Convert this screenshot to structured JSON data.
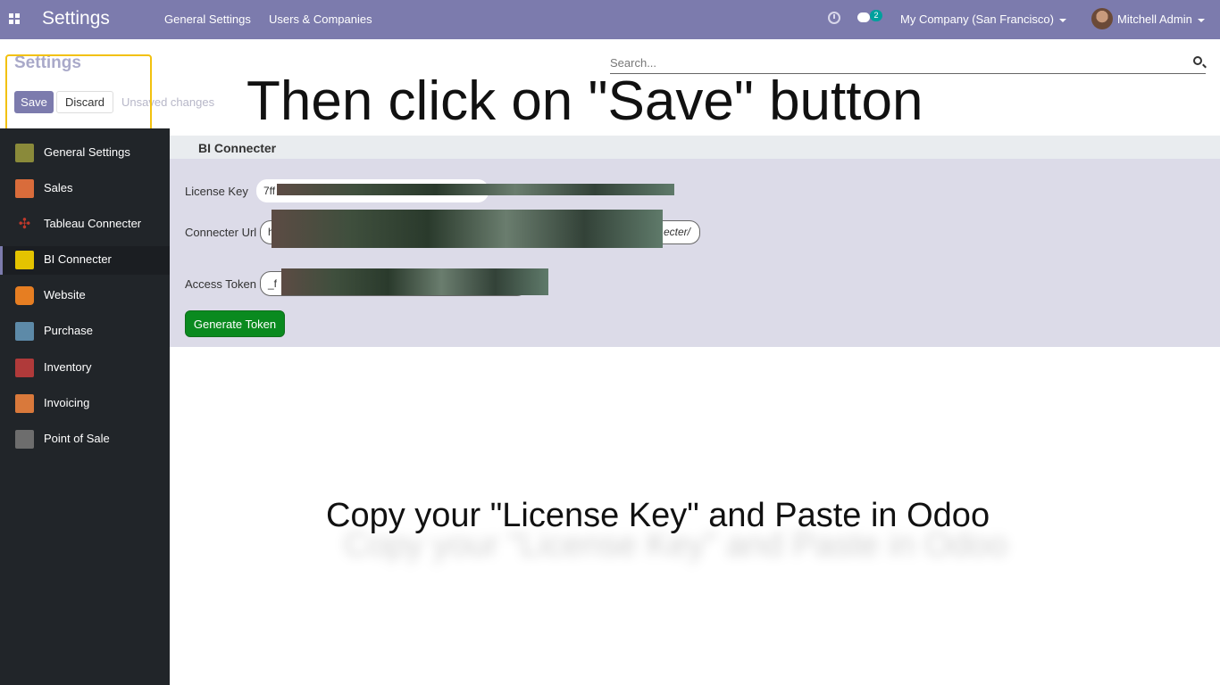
{
  "navbar": {
    "brand": "Settings",
    "menus": [
      "General Settings",
      "Users & Companies"
    ],
    "chat_count": "2",
    "company": "My Company (San Francisco)",
    "user": "Mitchell Admin"
  },
  "control_panel": {
    "title": "Settings",
    "save_label": "Save",
    "discard_label": "Discard",
    "unsaved_text": "Unsaved changes",
    "search_placeholder": "Search..."
  },
  "overlay": {
    "instruction_top": "Then click on \"Save\" button",
    "instruction_bottom": "Copy your \"License Key\" and Paste in Odoo"
  },
  "sidebar": {
    "items": [
      {
        "label": "General Settings",
        "color": "#8a8a3a"
      },
      {
        "label": "Sales",
        "color": "#d96c3b"
      },
      {
        "label": "Tableau Connecter",
        "color": "#c0392b"
      },
      {
        "label": "BI Connecter",
        "color": "#e4c300"
      },
      {
        "label": "Website",
        "color": "#e67e22"
      },
      {
        "label": "Purchase",
        "color": "#5d8aa8"
      },
      {
        "label": "Inventory",
        "color": "#b03a3a"
      },
      {
        "label": "Invoicing",
        "color": "#d9793b"
      },
      {
        "label": "Point of Sale",
        "color": "#6d6d6d"
      }
    ]
  },
  "section": {
    "title": "BI Connecter",
    "license_key_label": "License Key",
    "license_key_value": "7ff",
    "connecter_url_label": "Connecter Url",
    "connecter_url_value_start": "h",
    "connecter_url_value_end": "ecter/",
    "access_token_label": "Access Token",
    "access_token_value": "_f",
    "generate_token_label": "Generate Token"
  }
}
